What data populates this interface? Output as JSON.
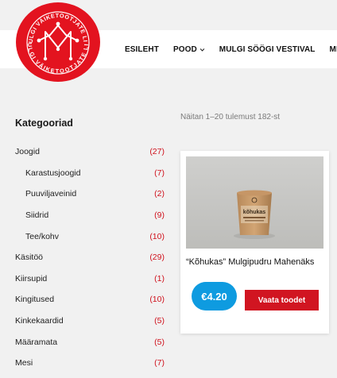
{
  "logo": {
    "ring_text_top": "MULGI VÄIKETOOTJATE LIIT",
    "ring_text_bottom": "MULGI VÄIKETOOTJATE LIIT",
    "color": "#e3131f"
  },
  "nav": {
    "items": [
      {
        "label": "ESILEHT"
      },
      {
        "label": "POOD",
        "has_dropdown": true
      },
      {
        "label": "MULGI SÖÖGI VESTIVAL"
      },
      {
        "label": "MEI"
      }
    ]
  },
  "sidebar": {
    "title": "Kategooriad",
    "categories": [
      {
        "label": "Joogid",
        "count": "(27)",
        "sub": false
      },
      {
        "label": "Karastusjoogid",
        "count": "(7)",
        "sub": true
      },
      {
        "label": "Puuviljaveinid",
        "count": "(2)",
        "sub": true
      },
      {
        "label": "Siidrid",
        "count": "(9)",
        "sub": true
      },
      {
        "label": "Tee/kohv",
        "count": "(10)",
        "sub": true
      },
      {
        "label": "Käsitöö",
        "count": "(29)",
        "sub": false
      },
      {
        "label": "Kiirsupid",
        "count": "(1)",
        "sub": false
      },
      {
        "label": "Kingitused",
        "count": "(10)",
        "sub": false
      },
      {
        "label": "Kinkekaardid",
        "count": "(5)",
        "sub": false
      },
      {
        "label": "Määramata",
        "count": "(5)",
        "sub": false
      },
      {
        "label": "Mesi",
        "count": "(7)",
        "sub": false
      }
    ]
  },
  "results": {
    "count_text": "Näitan 1–20 tulemust 182-st"
  },
  "product": {
    "title": "“Kõhukas” Mulgipudru Mahenäks",
    "price": "€4.20",
    "button_label": "Vaata toodet",
    "image_label": "kõhukas"
  },
  "colors": {
    "accent_red": "#d11521",
    "price_blue": "#0e9be0",
    "background": "#f1f1f1"
  }
}
